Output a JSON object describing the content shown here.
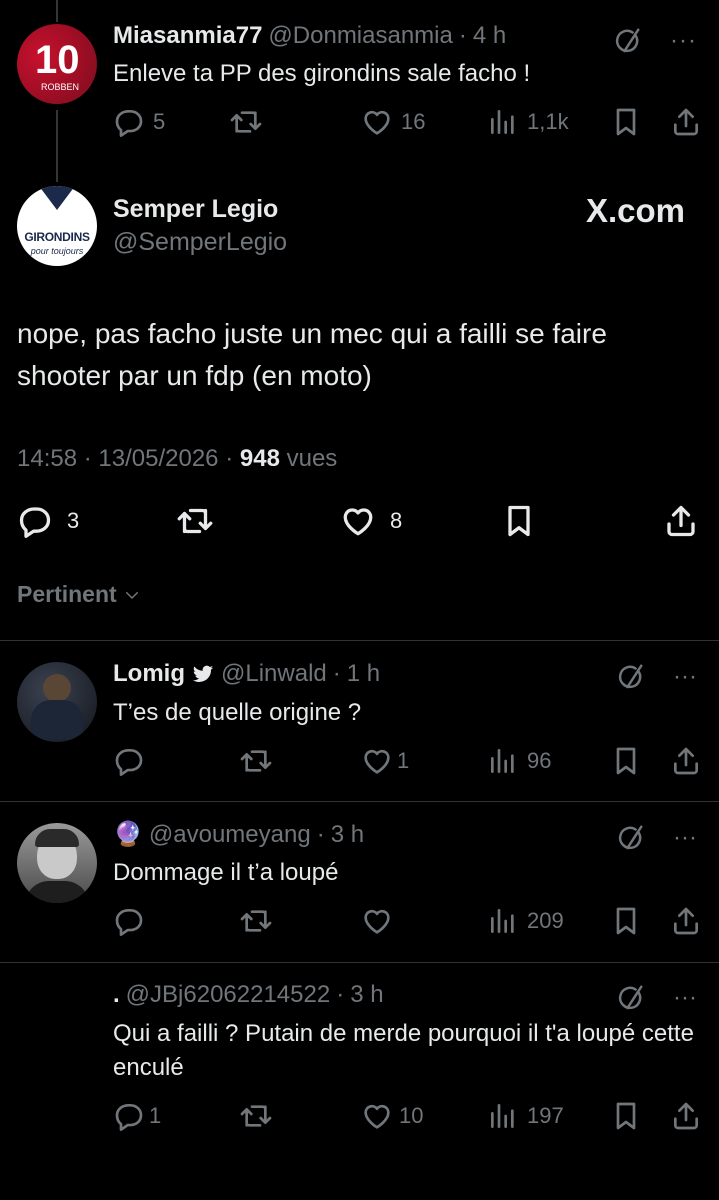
{
  "parent_tweet": {
    "name": "Miasanmia77",
    "handle": "@Donmiasanmia",
    "time": "4 h",
    "text": "Enleve ta PP des girondins sale facho !",
    "replies": "5",
    "retweets": "",
    "likes": "16",
    "views": "1,1k",
    "avatar_text": "10",
    "avatar_subtext": "ROBBEN"
  },
  "main_tweet": {
    "name": "Semper Legio",
    "handle": "@SemperLegio",
    "watermark": "X.com",
    "avatar_text": "GIRONDINS",
    "avatar_subtext": "pour toujours",
    "text": "nope, pas facho juste un mec qui a failli se faire shooter par un fdp (en moto)",
    "time": "14:58",
    "date": "13/05/2026",
    "views_count": "948",
    "views_label": "vues",
    "replies": "3",
    "likes": "8"
  },
  "sort": {
    "label": "Pertinent"
  },
  "replies": [
    {
      "name": "Lomig",
      "verified_icon": "bird-icon",
      "handle": "@Linwald",
      "time": "1 h",
      "text": "T’es de quelle origine ?",
      "replies": "",
      "likes": "1",
      "views": "96"
    },
    {
      "name": "🔮",
      "handle": "@avoumeyang",
      "time": "3 h",
      "text": "Dommage il t’a loupé",
      "replies": "",
      "likes": "",
      "views": "209"
    },
    {
      "name": ".",
      "handle": "@JBj62062214522",
      "time": "3 h",
      "text": "Qui a failli ? Putain de merde pourquoi il t'a loupé cette enculé",
      "replies": "1",
      "likes": "10",
      "views": "197"
    }
  ],
  "separator": "·",
  "colors": {
    "background": "#000000",
    "text": "#e7e9ea",
    "muted": "#71767b",
    "divider": "#2f3336"
  }
}
